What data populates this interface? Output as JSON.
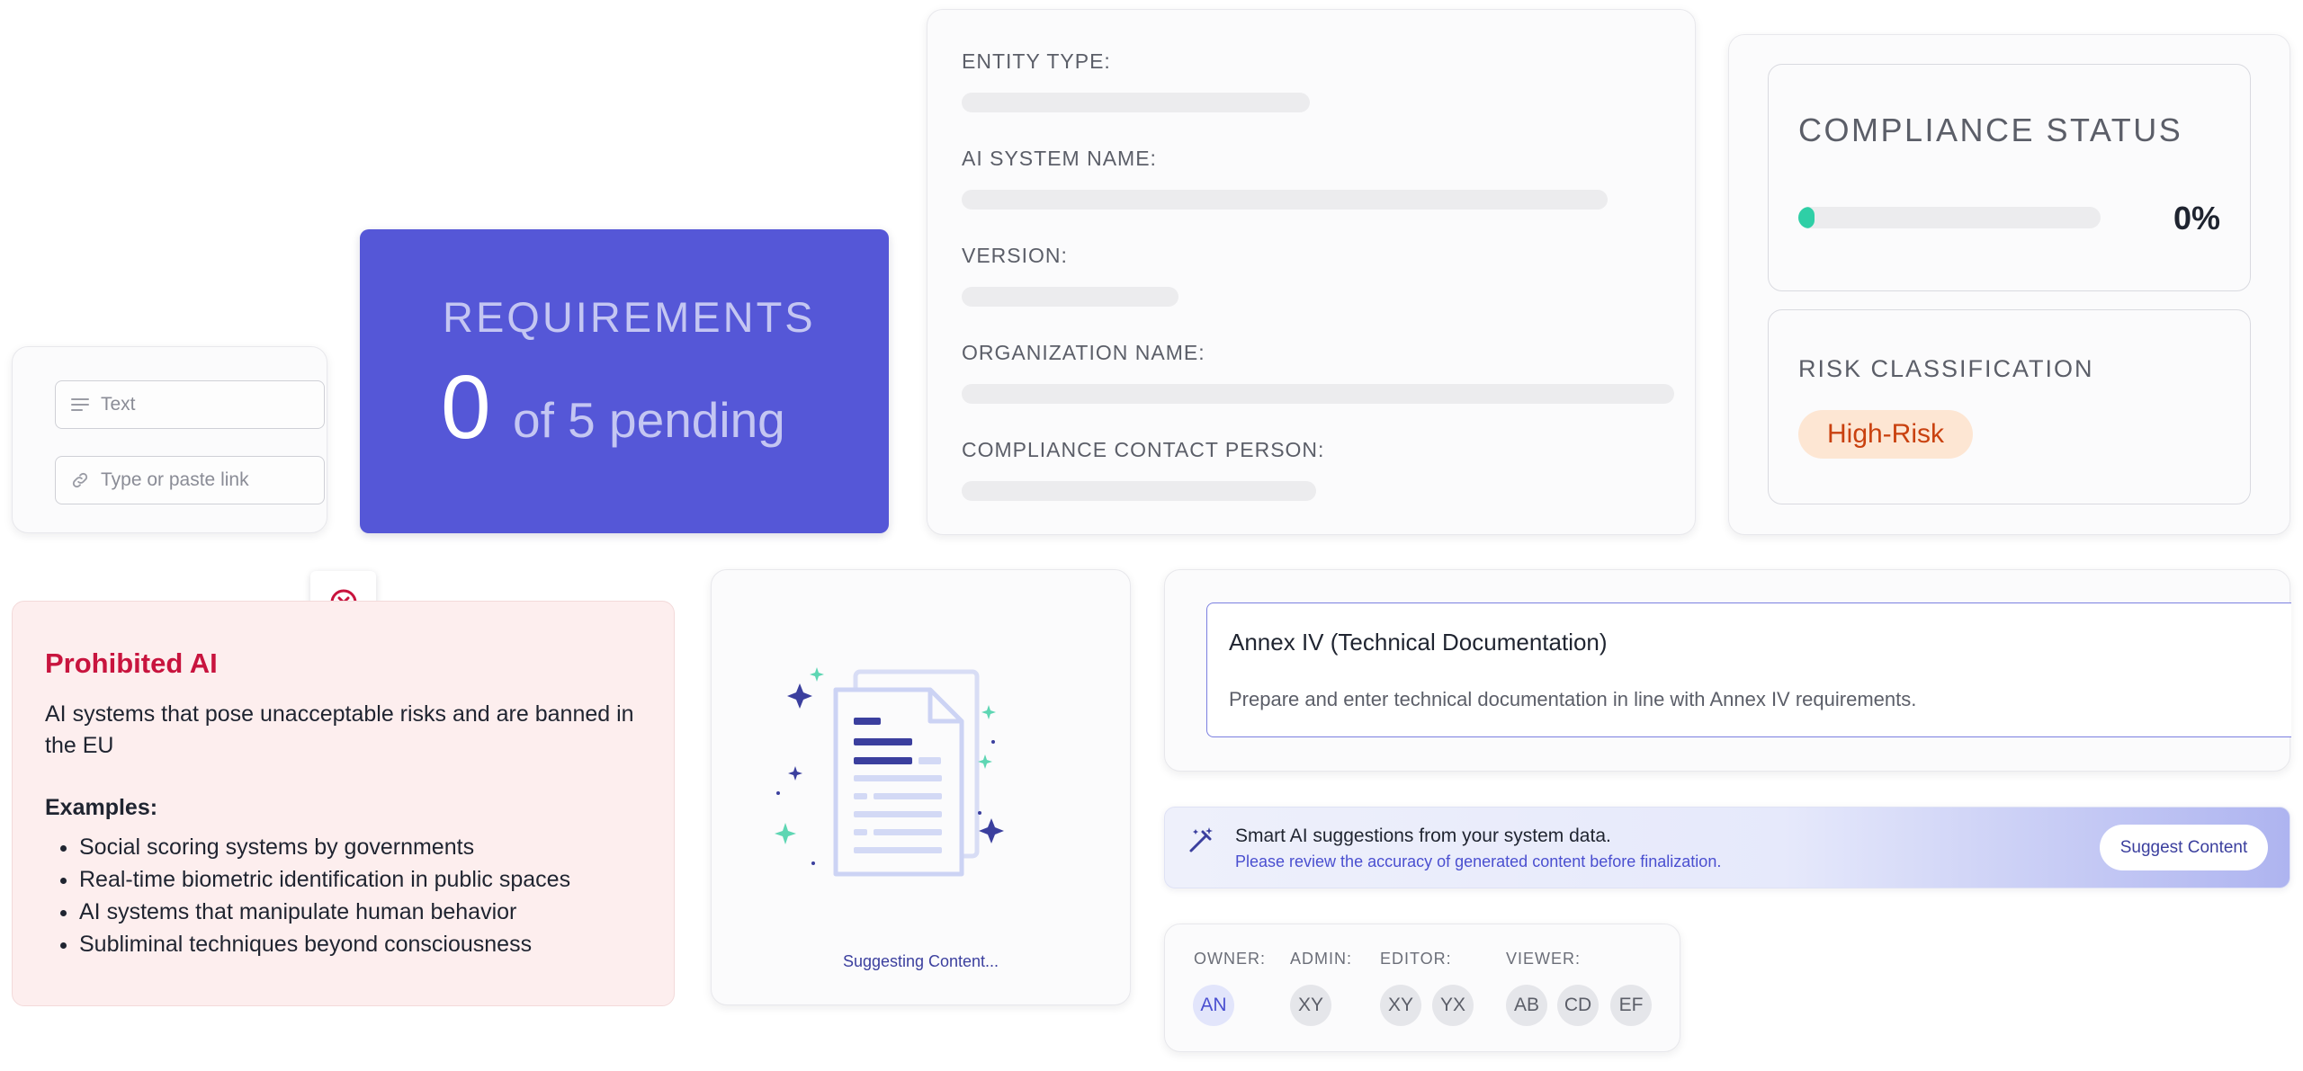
{
  "inputs": {
    "text_placeholder": "Text",
    "link_placeholder": "Type or paste link"
  },
  "requirements": {
    "title": "REQUIREMENTS",
    "count": "0",
    "suffix": "of 5 pending"
  },
  "entity_form": {
    "fields": [
      {
        "label": "ENTITY TYPE:"
      },
      {
        "label": "AI SYSTEM NAME:"
      },
      {
        "label": "VERSION:"
      },
      {
        "label": "ORGANIZATION NAME:"
      },
      {
        "label": "COMPLIANCE CONTACT PERSON:"
      }
    ]
  },
  "compliance": {
    "title": "COMPLIANCE STATUS",
    "percent_label": "0%",
    "progress_fraction": 0.0
  },
  "risk": {
    "title": "RISK CLASSIFICATION",
    "badge": "High-Risk"
  },
  "prohibited": {
    "title": "Prohibited AI",
    "description": "AI systems that pose unacceptable risks and are banned in the EU",
    "examples_label": "Examples:",
    "examples": [
      "Social scoring systems by governments",
      "Real-time biometric identification in public spaces",
      "AI systems that manipulate human behavior",
      "Subliminal techniques beyond consciousness"
    ]
  },
  "suggesting": {
    "status": "Suggesting Content..."
  },
  "annex": {
    "title": "Annex IV (Technical Documentation)",
    "description": "Prepare and enter technical documentation in line with Annex IV requirements."
  },
  "smart_ai": {
    "title": "Smart AI suggestions from your system data.",
    "subtitle": "Please review the accuracy of generated content before finalization.",
    "button": "Suggest Content"
  },
  "roles": {
    "owner": {
      "label": "OWNER:",
      "avatars": [
        "AN"
      ]
    },
    "admin": {
      "label": "ADMIN:",
      "avatars": [
        "XY"
      ]
    },
    "editor": {
      "label": "EDITOR:",
      "avatars": [
        "XY",
        "YX"
      ]
    },
    "viewer": {
      "label": "VIEWER:",
      "avatars": [
        "AB",
        "CD",
        "EF"
      ]
    }
  },
  "colors": {
    "accent": "#5557d7",
    "progress": "#2fcfa6",
    "danger": "#c8143e",
    "risk_badge_bg": "#fde6d3",
    "risk_badge_text": "#c9410f"
  }
}
